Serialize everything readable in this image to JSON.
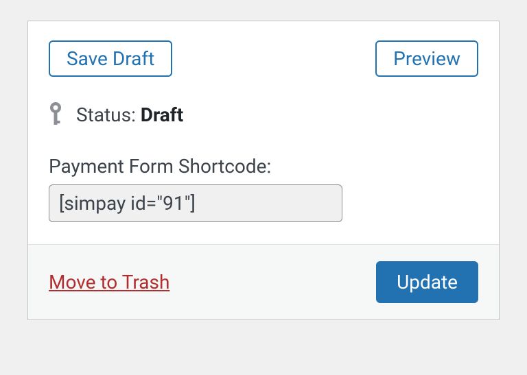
{
  "actions": {
    "save_draft": "Save Draft",
    "preview": "Preview",
    "trash": "Move to Trash",
    "update": "Update"
  },
  "status": {
    "label": "Status: ",
    "value": "Draft"
  },
  "shortcode": {
    "label": "Payment Form Shortcode:",
    "value": "[simpay id=\"91\"]"
  }
}
